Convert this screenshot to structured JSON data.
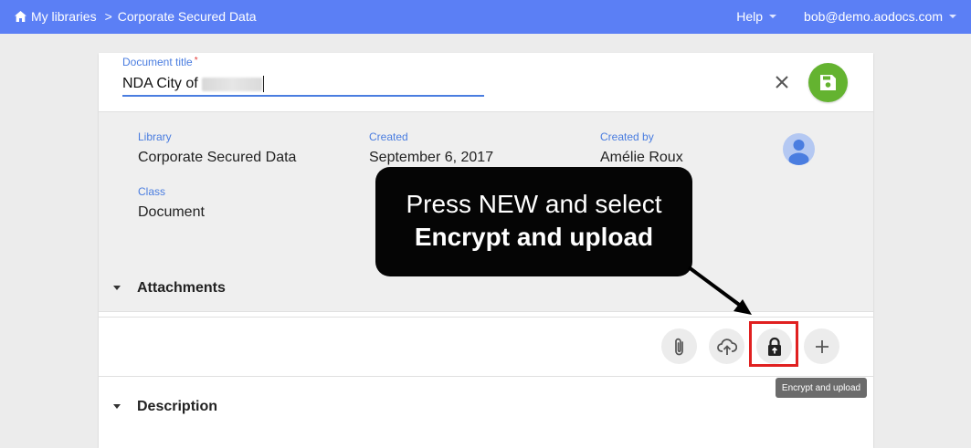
{
  "topbar": {
    "breadcrumb_root": "My libraries",
    "breadcrumb_sep": ">",
    "breadcrumb_current": "Corporate Secured Data",
    "help_label": "Help",
    "user_email": "bob@demo.aodocs.com",
    "color": "#5b7ff5"
  },
  "document": {
    "title_label": "Document title",
    "required_mark": "*",
    "title_value": "NDA City of"
  },
  "meta": {
    "library_label": "Library",
    "library_value": "Corporate Secured Data",
    "created_label": "Created",
    "created_value": "September 6, 2017",
    "created_by_label": "Created by",
    "created_by_value": "Amélie Roux",
    "class_label": "Class",
    "class_value": "Document"
  },
  "sections": {
    "attachments": "Attachments",
    "description": "Description"
  },
  "actions": {
    "icons": [
      "paperclip-icon",
      "cloud-upload-icon",
      "lock-upload-icon",
      "plus-icon"
    ],
    "tooltip": "Encrypt and upload"
  },
  "callout": {
    "line1": "Press NEW and select",
    "line2": "Encrypt and upload"
  },
  "colors": {
    "accent": "#4a7de0",
    "save": "#64b330",
    "highlight": "#e02020"
  }
}
